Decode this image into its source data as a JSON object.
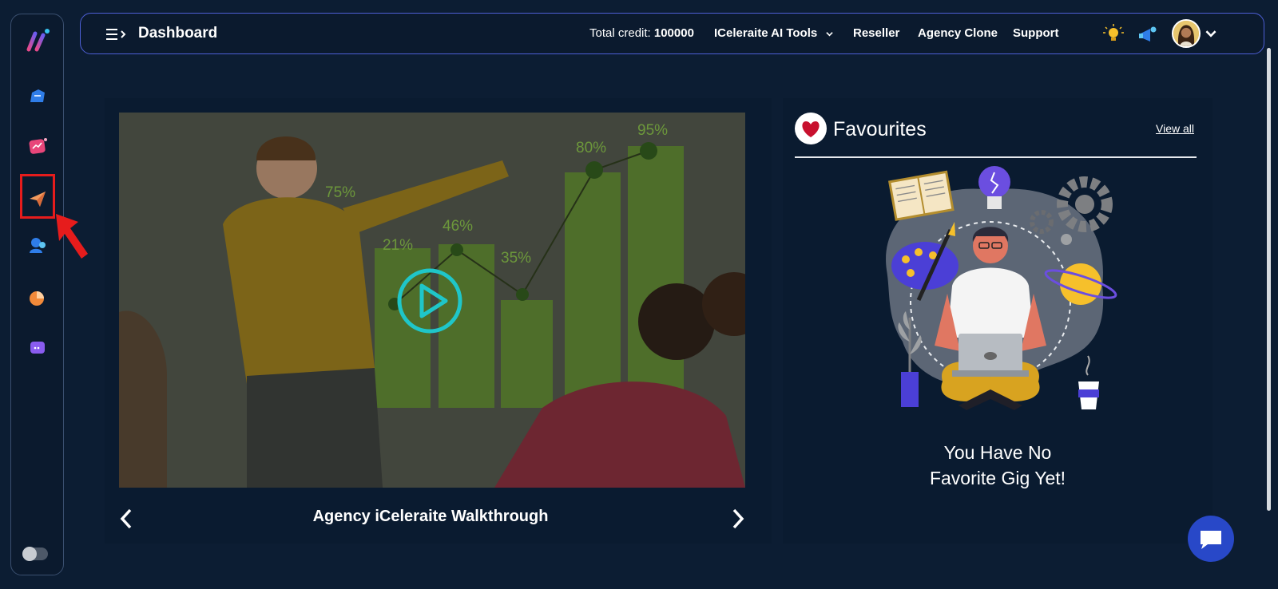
{
  "header": {
    "title": "Dashboard",
    "credit_label": "Total credit:",
    "credit_value": "100000",
    "nav": {
      "tools": "ICeleraite AI Tools",
      "reseller": "Reseller",
      "agency_clone": "Agency Clone",
      "support": "Support"
    }
  },
  "sidebar": {
    "icons": [
      "app-logo-icon",
      "home-icon",
      "analytics-icon",
      "send-icon",
      "users-icon",
      "chart-icon",
      "chat-bubble-icon"
    ],
    "toggle_state": "off"
  },
  "video": {
    "title": "Agency iCeleraite Walkthrough",
    "chart_labels": [
      "95%",
      "80%",
      "75%",
      "46%",
      "21%",
      "35%"
    ]
  },
  "favourites": {
    "title": "Favourites",
    "view_all": "View all",
    "empty_line1": "You Have No",
    "empty_line2": "Favorite Gig Yet!"
  },
  "colors": {
    "background": "#0c1d33",
    "accent": "#4d5fd6",
    "highlight": "#e61c1c"
  }
}
